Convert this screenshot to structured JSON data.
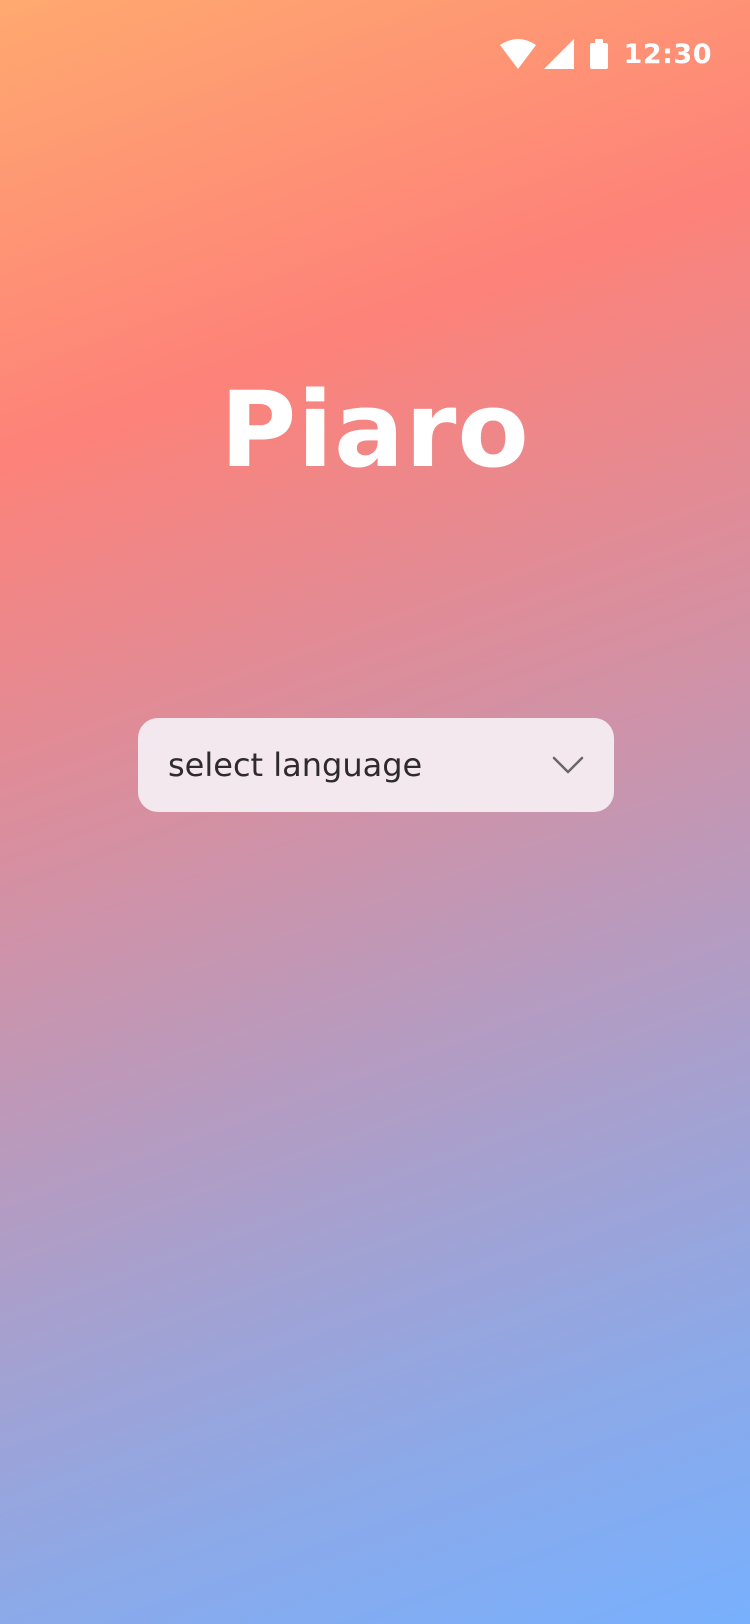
{
  "status_bar": {
    "time": "12:30",
    "icons": [
      "wifi-icon",
      "signal-icon",
      "battery-icon"
    ]
  },
  "app": {
    "logo_text": "Piaro"
  },
  "language_select": {
    "label": "select language",
    "icon": "chevron-down-icon"
  },
  "colors": {
    "gradient_top": "#ffa96f",
    "gradient_mid": "#fd8279",
    "gradient_bottom": "#78b0fd",
    "select_background": "#f2e8ee",
    "select_text": "#2f2a2c",
    "chevron": "#6b6668",
    "status_foreground": "#ffffff"
  }
}
